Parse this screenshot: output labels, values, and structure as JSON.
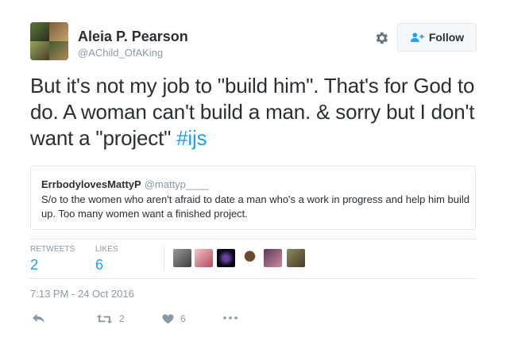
{
  "user": {
    "fullname": "Aleia P. Pearson",
    "handle": "@AChild_OfAKing"
  },
  "follow": {
    "label": "Follow"
  },
  "tweet": {
    "text": "But it's not my job to \"build him\". That's for God to do. A woman can't build a man. & sorry but I don't want a \"project\" ",
    "hashtag": "#ijs"
  },
  "quote": {
    "name": "ErrbodylovesMattyP",
    "handle": "@mattyp____",
    "text": "S/o to the women who aren't afraid to date a man who's a work in progress and help him build up. Too many women want a finished project."
  },
  "stats": {
    "retweets_label": "RETWEETS",
    "retweets_value": "2",
    "likes_label": "LIKES",
    "likes_value": "6"
  },
  "timestamp": "7:13 PM - 24 Oct 2016",
  "actions": {
    "retweet_count": "2",
    "like_count": "6"
  },
  "colors": {
    "accent": "#1da1f2",
    "text": "#292f33",
    "muted": "#8899a6"
  }
}
